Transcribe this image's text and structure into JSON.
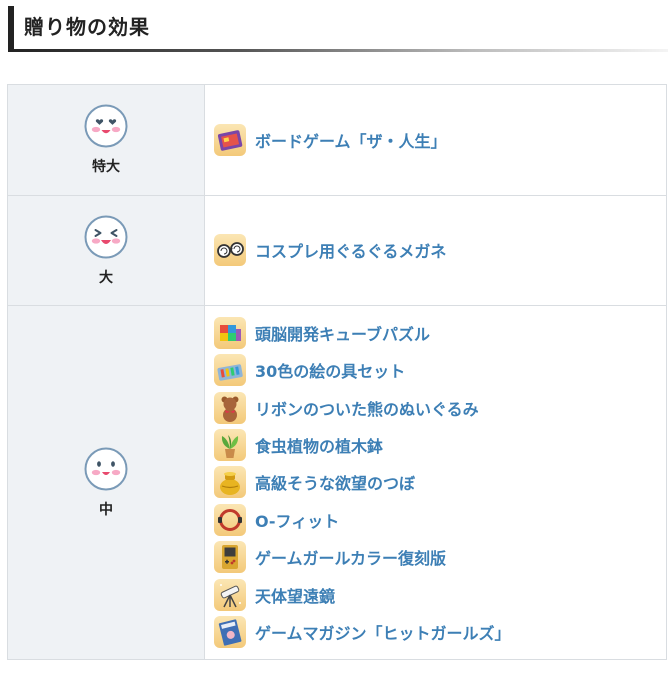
{
  "section": {
    "title": "贈り物の効果"
  },
  "colors": {
    "link": "#3d7fb5",
    "level_bg": "#eff2f5",
    "border": "#d9dde1"
  },
  "levels": [
    {
      "label": "特大",
      "face": "heart-eyes-face-icon",
      "items": [
        {
          "name": "ボードゲーム「ザ・人生」",
          "icon": "board-game-icon"
        }
      ]
    },
    {
      "label": "大",
      "face": "laughing-face-icon",
      "items": [
        {
          "name": "コスプレ用ぐるぐるメガネ",
          "icon": "swirl-glasses-icon"
        }
      ]
    },
    {
      "label": "中",
      "face": "smiling-face-icon",
      "items": [
        {
          "name": "頭脳開発キューブパズル",
          "icon": "cube-puzzle-icon"
        },
        {
          "name": "30色の絵の具セット",
          "icon": "paint-set-icon"
        },
        {
          "name": "リボンのついた熊のぬいぐるみ",
          "icon": "teddy-bear-icon"
        },
        {
          "name": "食虫植物の植木鉢",
          "icon": "potted-plant-icon"
        },
        {
          "name": "高級そうな欲望のつぼ",
          "icon": "golden-pot-icon"
        },
        {
          "name": "O-フィット",
          "icon": "fitness-ring-icon"
        },
        {
          "name": "ゲームガールカラー復刻版",
          "icon": "handheld-console-icon"
        },
        {
          "name": "天体望遠鏡",
          "icon": "telescope-icon"
        },
        {
          "name": "ゲームマガジン「ヒットガールズ」",
          "icon": "magazine-icon"
        }
      ]
    }
  ]
}
